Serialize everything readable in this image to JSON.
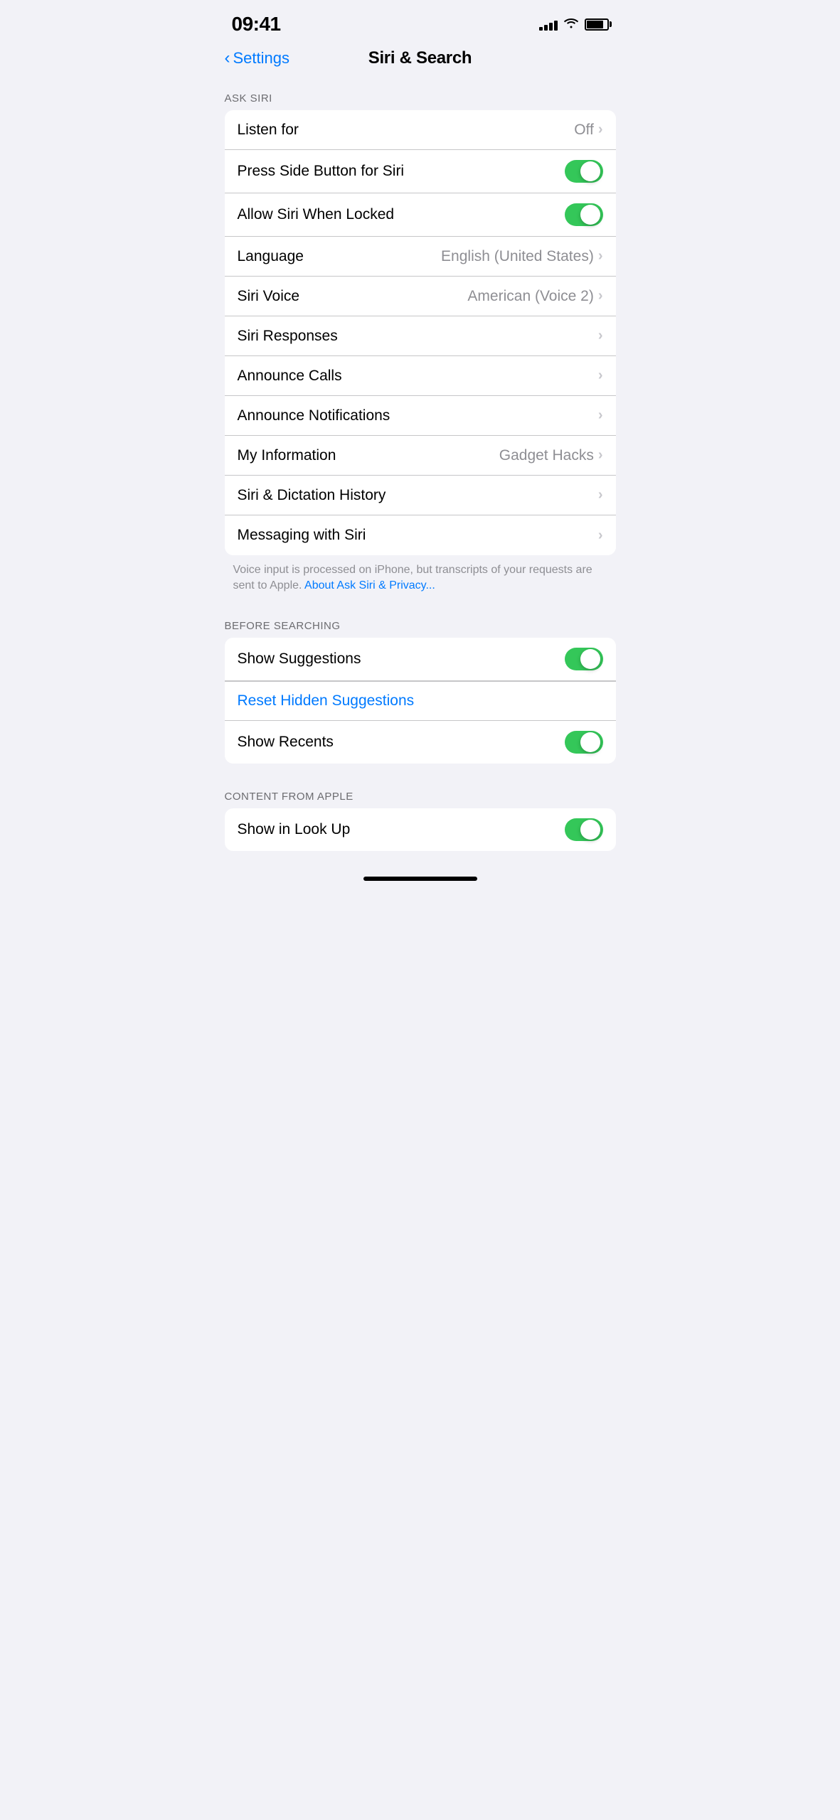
{
  "statusBar": {
    "time": "09:41",
    "signalBars": [
      4,
      6,
      9,
      12,
      15
    ],
    "batteryLevel": 85
  },
  "navigation": {
    "backLabel": "Settings",
    "title": "Siri & Search"
  },
  "sections": {
    "askSiri": {
      "header": "ASK SIRI",
      "rows": [
        {
          "id": "listen-for",
          "label": "Listen for",
          "value": "Off",
          "type": "chevron"
        },
        {
          "id": "press-side-button",
          "label": "Press Side Button for Siri",
          "value": null,
          "type": "toggle",
          "enabled": true
        },
        {
          "id": "allow-locked",
          "label": "Allow Siri When Locked",
          "value": null,
          "type": "toggle",
          "enabled": true
        },
        {
          "id": "language",
          "label": "Language",
          "value": "English (United States)",
          "type": "chevron"
        },
        {
          "id": "siri-voice",
          "label": "Siri Voice",
          "value": "American (Voice 2)",
          "type": "chevron"
        },
        {
          "id": "siri-responses",
          "label": "Siri Responses",
          "value": null,
          "type": "chevron"
        },
        {
          "id": "announce-calls",
          "label": "Announce Calls",
          "value": null,
          "type": "chevron"
        },
        {
          "id": "announce-notifications",
          "label": "Announce Notifications",
          "value": null,
          "type": "chevron"
        },
        {
          "id": "my-information",
          "label": "My Information",
          "value": "Gadget Hacks",
          "type": "chevron"
        },
        {
          "id": "siri-dictation-history",
          "label": "Siri & Dictation History",
          "value": null,
          "type": "chevron"
        },
        {
          "id": "messaging-with-siri",
          "label": "Messaging with Siri",
          "value": null,
          "type": "chevron"
        }
      ],
      "footer": "Voice input is processed on iPhone, but transcripts of your requests are sent to Apple.",
      "footerLink": "About Ask Siri & Privacy..."
    },
    "beforeSearching": {
      "header": "BEFORE SEARCHING",
      "rows": [
        {
          "id": "show-suggestions",
          "label": "Show Suggestions",
          "value": null,
          "type": "toggle",
          "enabled": true
        }
      ],
      "actionRow": {
        "id": "reset-hidden-suggestions",
        "label": "Reset Hidden Suggestions"
      },
      "rows2": [
        {
          "id": "show-recents",
          "label": "Show Recents",
          "value": null,
          "type": "toggle",
          "enabled": true
        }
      ]
    },
    "contentFromApple": {
      "header": "CONTENT FROM APPLE",
      "rows": [
        {
          "id": "show-in-look-up",
          "label": "Show in Look Up",
          "value": null,
          "type": "toggle",
          "enabled": true
        }
      ]
    }
  }
}
